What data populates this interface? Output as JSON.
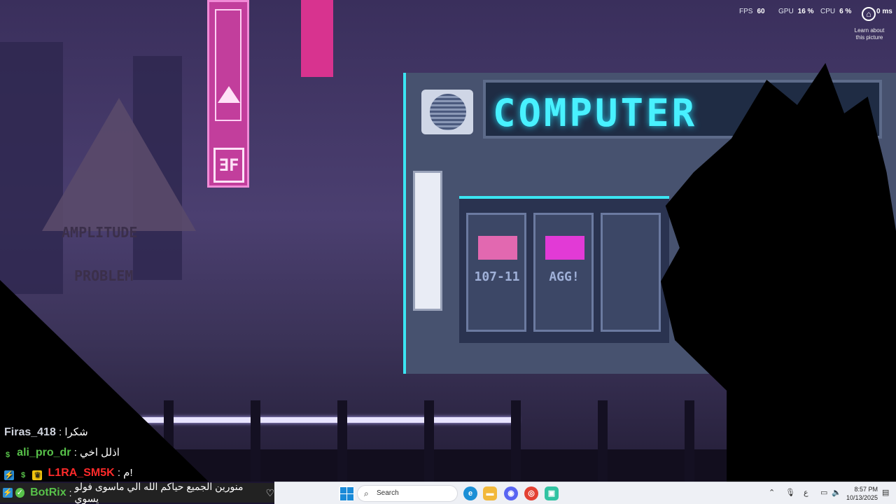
{
  "wallpaper": {
    "shop_sign": "COMPUTER",
    "pink_sign_code": "ƎF",
    "warning_line1": "AMPLITUDE",
    "warning_line2": "PROBLEM",
    "slot_labels": [
      "107-11",
      "AGG!"
    ]
  },
  "overlay": {
    "fps_label": "FPS",
    "fps_value": "60",
    "gpu_label": "GPU",
    "gpu_value": "16 %",
    "cpu_label": "CPU",
    "cpu_value": "6 %",
    "latency_value": "0 ms",
    "learn_text": "Learn about this picture"
  },
  "chat": {
    "messages": [
      {
        "user": "Firas_418",
        "text": "شكرا"
      },
      {
        "user": "ali_pro_dr",
        "text": "اذلل اخي",
        "badge": "$"
      },
      {
        "user": "L1RA_SM5K",
        "text": "م!",
        "badge": "$"
      }
    ],
    "bot": {
      "user": "BotRix",
      "text": "منورين الجميع حياكم الله الي ماسوى فولو يسوي"
    }
  },
  "taskbar": {
    "search_placeholder": "Search",
    "language": "ع",
    "time": "8:57 PM",
    "date": "10/13/2025",
    "apps": [
      "edge",
      "file-explorer",
      "discord",
      "chrome",
      "streamlabs"
    ]
  },
  "colors": {
    "neon_cyan": "#3be5f2",
    "neon_pink": "#c23e9c",
    "chat_green": "#58c24a",
    "chat_red": "#ff2a2a",
    "taskbar_bg": "#eef0f5"
  }
}
